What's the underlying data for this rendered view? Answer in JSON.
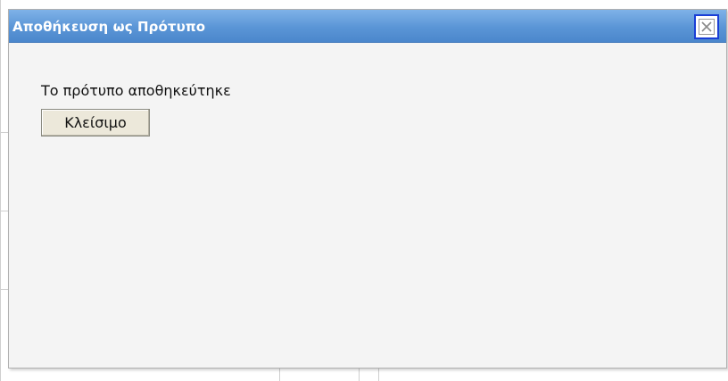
{
  "dialog": {
    "title": "Αποθήκευση ως Πρότυπο",
    "close_icon": "close-icon",
    "message": "Το πρότυπο αποθηκεύτηκε",
    "close_label": "Κλείσιμο"
  },
  "colors": {
    "titlebar": "#5a95d6",
    "title_text": "#ffffff",
    "dialog_body": "#f4f4f4",
    "close_border": "#1a3fd6",
    "button_face": "#ece8da"
  }
}
